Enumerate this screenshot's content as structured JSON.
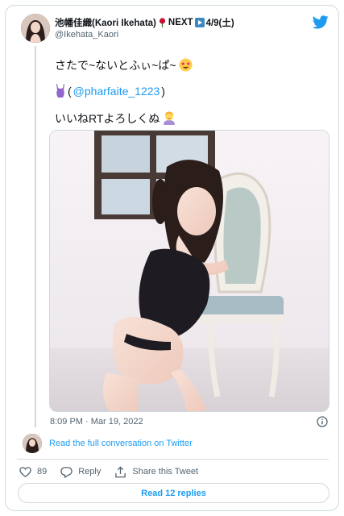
{
  "header": {
    "display_name": "池幡佳織(Kaori Ikehata)",
    "name_suffix": "NEXT",
    "name_date": "4/9(土)",
    "handle": "@Ikehata_Kaori"
  },
  "tweet": {
    "line1": "さたで~ないとふぃ~ぱ~",
    "line2_open": "(",
    "mention": "@pharfaite_1223",
    "line2_close": " )",
    "line3": "いいねRTよろしくぬ",
    "timestamp": "8:09 PM · Mar 19, 2022"
  },
  "footer": {
    "full_conversation": "Read the full conversation on Twitter",
    "like_count": "89",
    "reply_label": "Reply",
    "share_label": "Share this Tweet",
    "read_replies": "Read 12 replies"
  },
  "colors": {
    "accent": "#1d9bf0",
    "border": "#cfd9de",
    "muted": "#536471"
  },
  "icons": [
    "twitter-bird-icon",
    "rose-icon",
    "play-icon",
    "star-struck-emoji",
    "swimsuit-emoji",
    "person-emoji",
    "info-icon",
    "heart-icon",
    "reply-icon",
    "share-icon"
  ]
}
